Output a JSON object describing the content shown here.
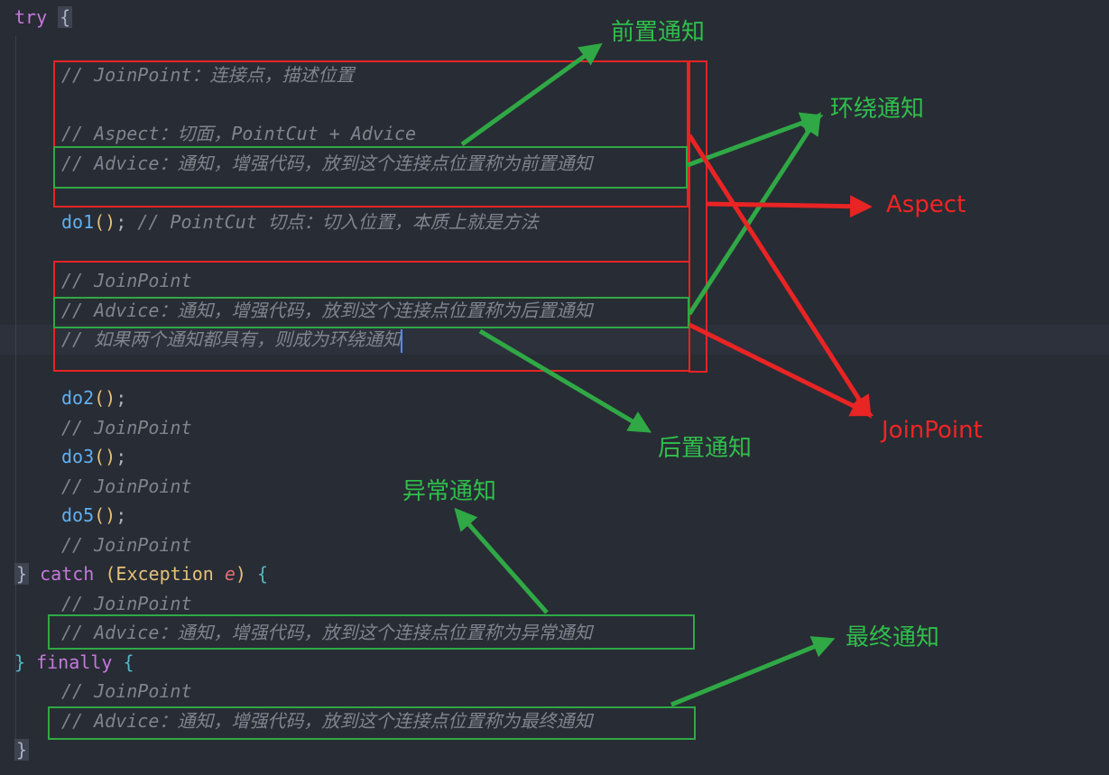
{
  "colors": {
    "background": "#282c34",
    "annotation_red": "#e82424",
    "annotation_green": "#2fa845"
  },
  "code": {
    "try_kw": "try",
    "try_brace": "{",
    "c_joinpoint_desc": "// JoinPoint：连接点，描述位置",
    "c_aspect_desc": "// Aspect：切面，PointCut + Advice",
    "c_advice_before": "// Advice：通知，增强代码，放到这个连接点位置称为前置通知",
    "do1_name": "do1",
    "do1_parens": "()",
    "do1_semi": ";",
    "c_pointcut_desc": " // PointCut 切点：切入位置，本质上就是方法",
    "c_joinpoint_1": "// JoinPoint",
    "c_advice_after": "// Advice：通知，增强代码，放到这个连接点位置称为后置通知",
    "c_around": "// 如果两个通知都具有，则成为环绕通知",
    "do2_name": "do2",
    "do2_parens": "()",
    "do2_semi": ";",
    "c_joinpoint_2": "// JoinPoint",
    "do3_name": "do3",
    "do3_parens": "()",
    "do3_semi": ";",
    "c_joinpoint_3": "// JoinPoint",
    "do5_name": "do5",
    "do5_parens": "()",
    "do5_semi": ";",
    "c_joinpoint_4": "// JoinPoint",
    "catch_close": "}",
    "catch_kw": "catch",
    "catch_open_paren": "(",
    "catch_type": "Exception",
    "catch_param": "e",
    "catch_close_paren": ")",
    "catch_brace": "{",
    "c_joinpoint_5": "// JoinPoint",
    "c_advice_exception": "// Advice：通知，增强代码，放到这个连接点位置称为异常通知",
    "finally_close": "}",
    "finally_kw": "finally",
    "finally_brace": "{",
    "c_joinpoint_6": "// JoinPoint",
    "c_advice_final": "// Advice：通知，增强代码，放到这个连接点位置称为最终通知",
    "end_brace": "}"
  },
  "labels": {
    "before_advice": "前置通知",
    "around_advice": "环绕通知",
    "aspect": "Aspect",
    "after_advice": "后置通知",
    "joinpoint": "JoinPoint",
    "exception_advice": "异常通知",
    "final_advice": "最终通知"
  }
}
